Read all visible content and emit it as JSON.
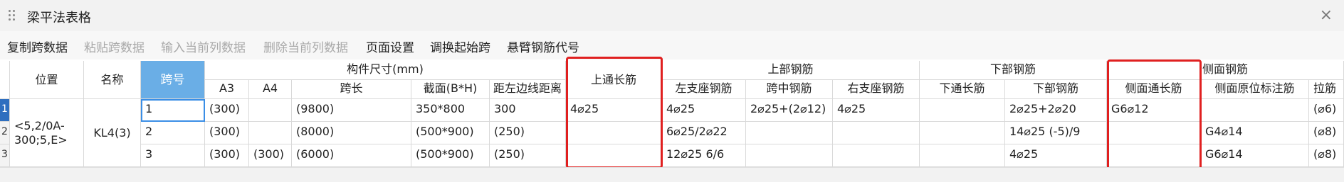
{
  "window": {
    "title": "梁平法表格",
    "close_glyph": "×"
  },
  "toolbar": {
    "copy": "复制跨数据",
    "paste": "粘贴跨数据",
    "insert": "输入当前列数据",
    "delete": "删除当前列数据",
    "page_setup": "页面设置",
    "swap_start": "调换起始跨",
    "cantilever": "悬臂钢筋代号"
  },
  "headers": {
    "position": "位置",
    "name": "名称",
    "span_no": "跨号",
    "group_dims": "构件尺寸(mm)",
    "a3": "A3",
    "a4": "A4",
    "span_len": "跨长",
    "section": "截面(B*H)",
    "offset": "距左边线距离",
    "top_through": "上通长筋",
    "group_top": "上部钢筋",
    "left_support": "左支座钢筋",
    "mid_span": "跨中钢筋",
    "right_support": "右支座钢筋",
    "group_bottom": "下部钢筋",
    "bottom_through": "下通长筋",
    "bottom_bar": "下部钢筋",
    "group_side": "侧面钢筋",
    "side_through": "侧面通长筋",
    "side_orig": "侧面原位标注筋",
    "tie": "拉筋"
  },
  "rows_meta": {
    "position": "<5,2/0A-300;5,E>",
    "name": "KL4(3)"
  },
  "rows": [
    {
      "num": "1",
      "span": "1",
      "a3": "(300)",
      "a4": "",
      "len": "(9800)",
      "section": "350*800",
      "offset": "300",
      "top_through": "4⌀25",
      "left": "4⌀25",
      "mid": "2⌀25+(2⌀12)",
      "right": "4⌀25",
      "bot_through": "",
      "bottom": "2⌀25+2⌀20",
      "side_through": "G6⌀12",
      "side_orig": "",
      "tie": "(⌀6)"
    },
    {
      "num": "2",
      "span": "2",
      "a3": "(300)",
      "a4": "",
      "len": "(8000)",
      "section": "(500*900)",
      "offset": "(250)",
      "top_through": "",
      "left": "6⌀25/2⌀22",
      "mid": "",
      "right": "",
      "bot_through": "",
      "bottom": "14⌀25 (-5)/9",
      "side_through": "",
      "side_orig": "G4⌀14",
      "tie": "(⌀8)"
    },
    {
      "num": "3",
      "span": "3",
      "a3": "(300)",
      "a4": "(300)",
      "len": "(6000)",
      "section": "(500*900)",
      "offset": "(250)",
      "top_through": "",
      "left": "12⌀25 6/6",
      "mid": "",
      "right": "",
      "bot_through": "",
      "bottom": "4⌀25",
      "side_through": "",
      "side_orig": "G6⌀14",
      "tie": "(⌀8)"
    }
  ],
  "colors": {
    "highlight_box": "#e02020",
    "selected_header": "#6aaee6",
    "active_row": "#2f6fbf"
  }
}
